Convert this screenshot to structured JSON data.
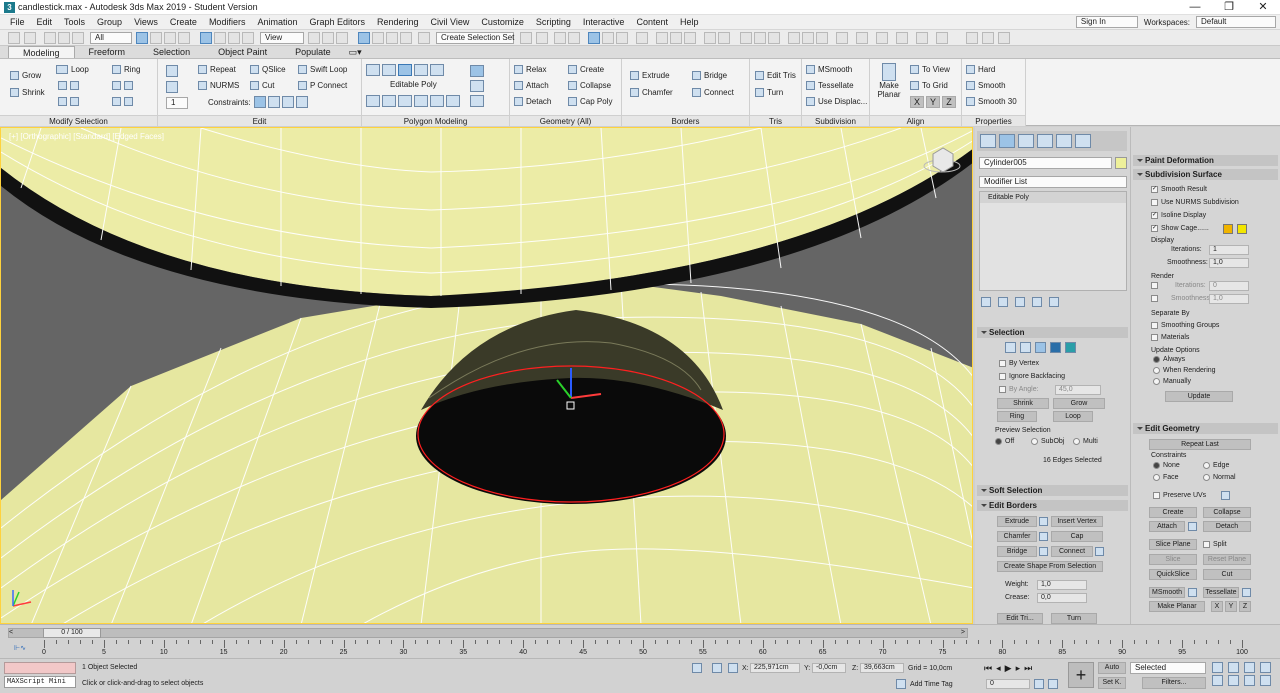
{
  "window": {
    "title": "candlestick.max - Autodesk 3ds Max 2019 - Student Version",
    "controls": [
      "—",
      "❐",
      "✕"
    ]
  },
  "menu": {
    "items": [
      "File",
      "Edit",
      "Tools",
      "Group",
      "Views",
      "Create",
      "Modifiers",
      "Animation",
      "Graph Editors",
      "Rendering",
      "Civil View",
      "Customize",
      "Scripting",
      "Interactive",
      "Content",
      "Help"
    ],
    "sign_in": "Sign In",
    "workspaces_label": "Workspaces:",
    "workspaces_value": "Default"
  },
  "toolbar": {
    "filter": "All",
    "coord": "View",
    "selection_set": "Create Selection Set"
  },
  "ribbon_tabs": [
    "Modeling",
    "Freeform",
    "Selection",
    "Object Paint",
    "Populate"
  ],
  "ribbon": {
    "modify_selection": {
      "title": "Modify Selection",
      "grow": "Grow",
      "shrink": "Shrink",
      "loop": "Loop",
      "ring": "Ring"
    },
    "edit": {
      "title": "Edit",
      "repeat": "Repeat",
      "nurms": "NURMS",
      "qslice": "QSlice",
      "cut": "Cut",
      "swift_loop": "Swift Loop",
      "p_connect": "P Connect",
      "constraints": "Constraints:",
      "spin_value": "1"
    },
    "polygon_modeling": {
      "title": "Polygon Modeling",
      "editable_poly": "Editable Poly"
    },
    "geometry": {
      "title": "Geometry (All)",
      "relax": "Relax",
      "attach": "Attach",
      "detach": "Detach",
      "create": "Create",
      "collapse": "Collapse",
      "cap_poly": "Cap Poly"
    },
    "borders": {
      "title": "Borders",
      "extrude": "Extrude",
      "chamfer": "Chamfer",
      "bridge": "Bridge",
      "connect": "Connect"
    },
    "tris": {
      "title": "Tris",
      "edit_tris": "Edit Tris",
      "turn": "Turn"
    },
    "subdivision": {
      "title": "Subdivision",
      "msmooth": "MSmooth",
      "tessellate": "Tessellate",
      "use_displac": "Use Displac..."
    },
    "align": {
      "title": "Align",
      "make_planar_1": "Make",
      "make_planar_2": "Planar",
      "to_view": "To View",
      "to_grid": "To Grid",
      "x": "X",
      "y": "Y",
      "z": "Z"
    },
    "properties": {
      "title": "Properties",
      "hard": "Hard",
      "smooth": "Smooth",
      "smooth30": "Smooth 30"
    }
  },
  "viewport": {
    "label": "[+] [Orthographic] [Standard] [Edged Faces]"
  },
  "command_panel": {
    "object_name": "Cylinder005",
    "modifier_list": "Modifier List",
    "stack_item": "Editable Poly",
    "selection": {
      "title": "Selection",
      "by_vertex": "By Vertex",
      "ignore_backfacing": "Ignore Backfacing",
      "by_angle": "By Angle:",
      "angle_value": "45,0",
      "shrink": "Shrink",
      "grow": "Grow",
      "ring": "Ring",
      "loop": "Loop",
      "preview_selection": "Preview Selection",
      "off": "Off",
      "subobj": "SubObj",
      "multi": "Multi",
      "status": "16 Edges Selected"
    },
    "soft_selection": {
      "title": "Soft Selection"
    },
    "edit_borders": {
      "title": "Edit Borders",
      "extrude": "Extrude",
      "insert_vertex": "Insert Vertex",
      "chamfer": "Chamfer",
      "cap": "Cap",
      "bridge": "Bridge",
      "connect": "Connect",
      "create_shape": "Create Shape From Selection",
      "weight": "Weight:",
      "weight_value": "1,0",
      "crease": "Crease:",
      "crease_value": "0,0",
      "edit_tri": "Edit Tri...",
      "turn": "Turn"
    }
  },
  "side_panel": {
    "paint_deformation": "Paint Deformation",
    "subdivision_surface": {
      "title": "Subdivision Surface",
      "smooth_result": "Smooth Result",
      "use_nurms": "Use NURMS Subdivision",
      "isoline": "Isoline Display",
      "show_cage": "Show Cage......",
      "display": "Display",
      "iterations": "Iterations:",
      "iterations_value": "1",
      "smoothness": "Smoothness:",
      "smoothness_value": "1,0",
      "render": "Render",
      "r_iterations": "Iterations:",
      "r_iterations_value": "0",
      "r_smoothness": "Smoothness:",
      "r_smoothness_value": "1,0",
      "separate_by": "Separate By",
      "smoothing_groups": "Smoothing Groups",
      "materials": "Materials",
      "update_options": "Update Options",
      "always": "Always",
      "when_rendering": "When Rendering",
      "manually": "Manually",
      "update": "Update"
    },
    "edit_geometry": {
      "title": "Edit Geometry",
      "repeat_last": "Repeat Last",
      "constraints": "Constraints",
      "none": "None",
      "edge": "Edge",
      "face": "Face",
      "normal": "Normal",
      "preserve_uvs": "Preserve UVs",
      "create": "Create",
      "collapse": "Collapse",
      "attach": "Attach",
      "detach": "Detach",
      "slice_plane": "Slice Plane",
      "split": "Split",
      "slice": "Slice",
      "reset_plane": "Reset Plane",
      "quickslice": "QuickSlice",
      "cut": "Cut",
      "msmooth": "MSmooth",
      "tessellate": "Tessellate",
      "make_planar": "Make Planar",
      "x": "X",
      "y": "Y",
      "z": "Z"
    }
  },
  "timeline": {
    "frame": "0 / 100",
    "ticks": [
      "0",
      "5",
      "10",
      "15",
      "20",
      "25",
      "30",
      "35",
      "40",
      "45",
      "50",
      "55",
      "60",
      "65",
      "70",
      "75",
      "80",
      "85",
      "90",
      "95",
      "100"
    ]
  },
  "status": {
    "maxscript": "MAXScript Mini",
    "selected": "1 Object Selected",
    "prompt": "Click or click-and-drag to select objects",
    "x_label": "X:",
    "x_value": "225,971cm",
    "y_label": "Y:",
    "y_value": "-0,0cm",
    "z_label": "Z:",
    "z_value": "39,663cm",
    "grid": "Grid = 10,0cm",
    "add_time_tag": "Add Time Tag",
    "auto": "Auto",
    "set_key": "Set K.",
    "selected_dd": "Selected",
    "filters": "Filters...",
    "frame_spin": "0"
  },
  "colors": {
    "mesh": "#ececa6",
    "selection": "#ff2020",
    "object_swatch": "#eef09a",
    "cage1": "#f0b400",
    "cage2": "#f2e600"
  }
}
